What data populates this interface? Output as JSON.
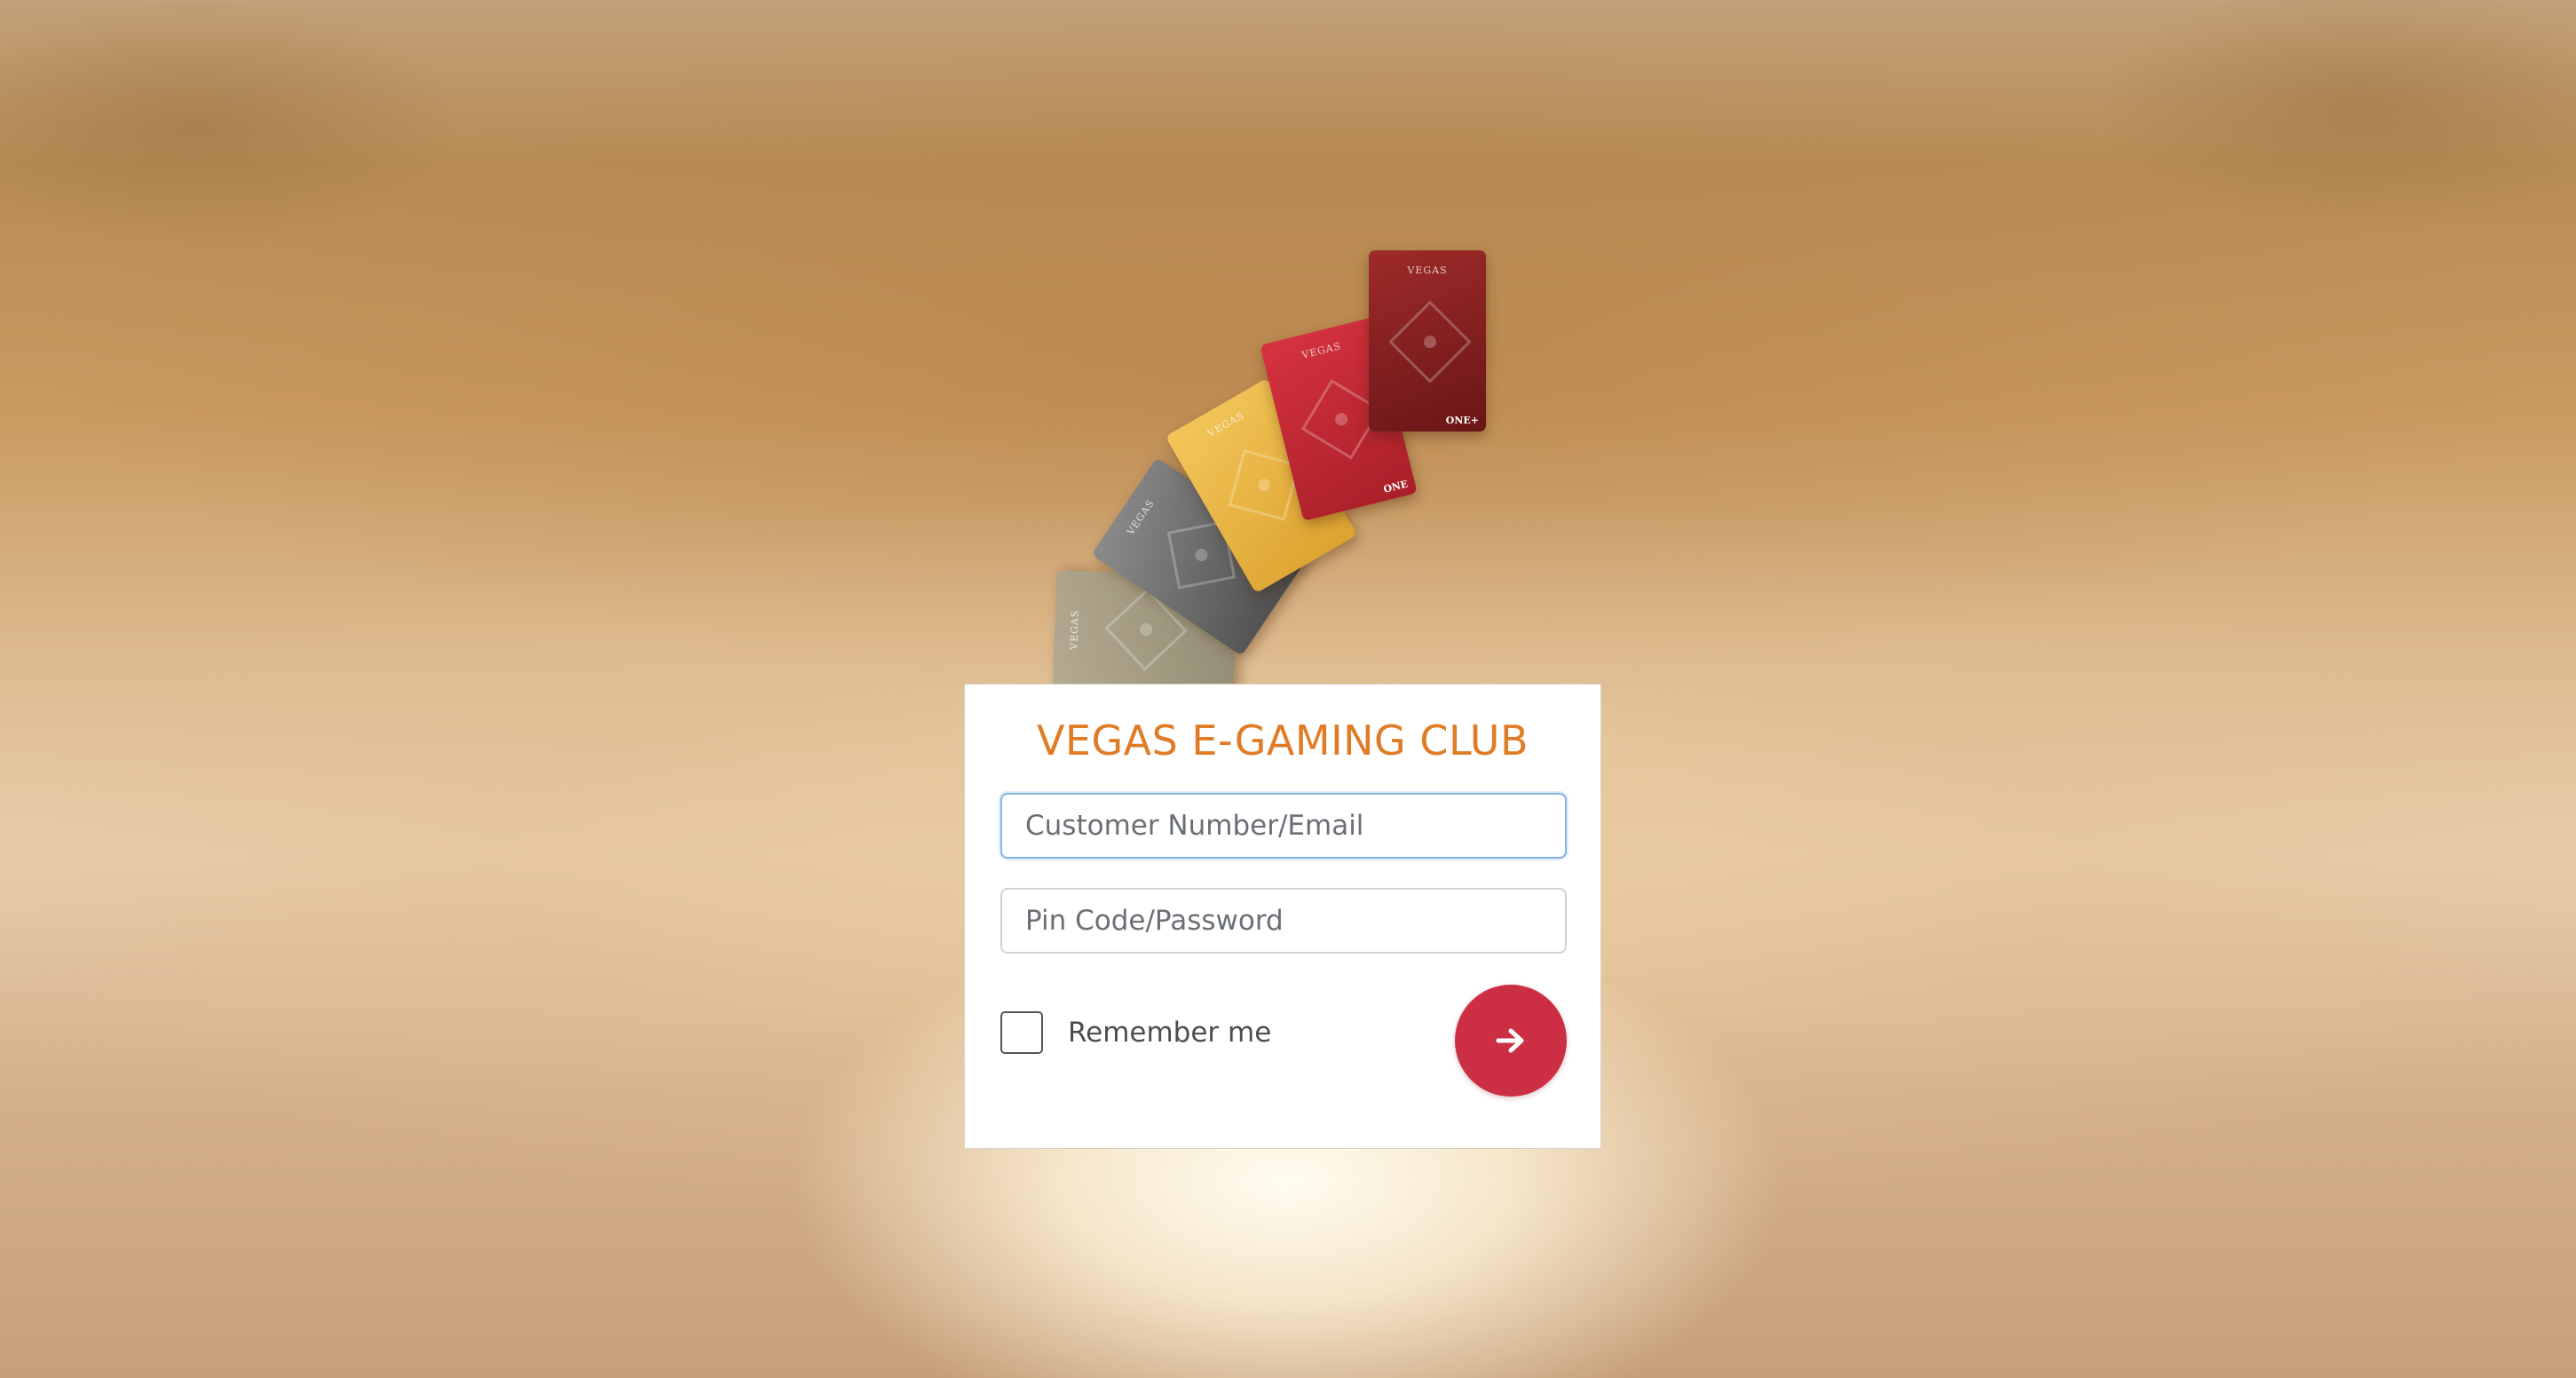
{
  "brand": {
    "title": "VEGAS E-GAMING CLUB",
    "accent_color": "#e07b26"
  },
  "cards": {
    "brand_text": "VEGAS",
    "items": [
      {
        "name": "olive-card",
        "tier": ""
      },
      {
        "name": "grey-card",
        "tier": ""
      },
      {
        "name": "gold-card",
        "tier": ""
      },
      {
        "name": "red-card",
        "tier": "ONE"
      },
      {
        "name": "burgundy-card",
        "tier": "ONE+"
      }
    ]
  },
  "login": {
    "username_placeholder": "Customer Number/Email",
    "password_placeholder": "Pin Code/Password",
    "remember_label": "Remember me",
    "remember_checked": false,
    "submit_icon": "arrow-right-icon",
    "submit_color": "#cc2f44"
  }
}
